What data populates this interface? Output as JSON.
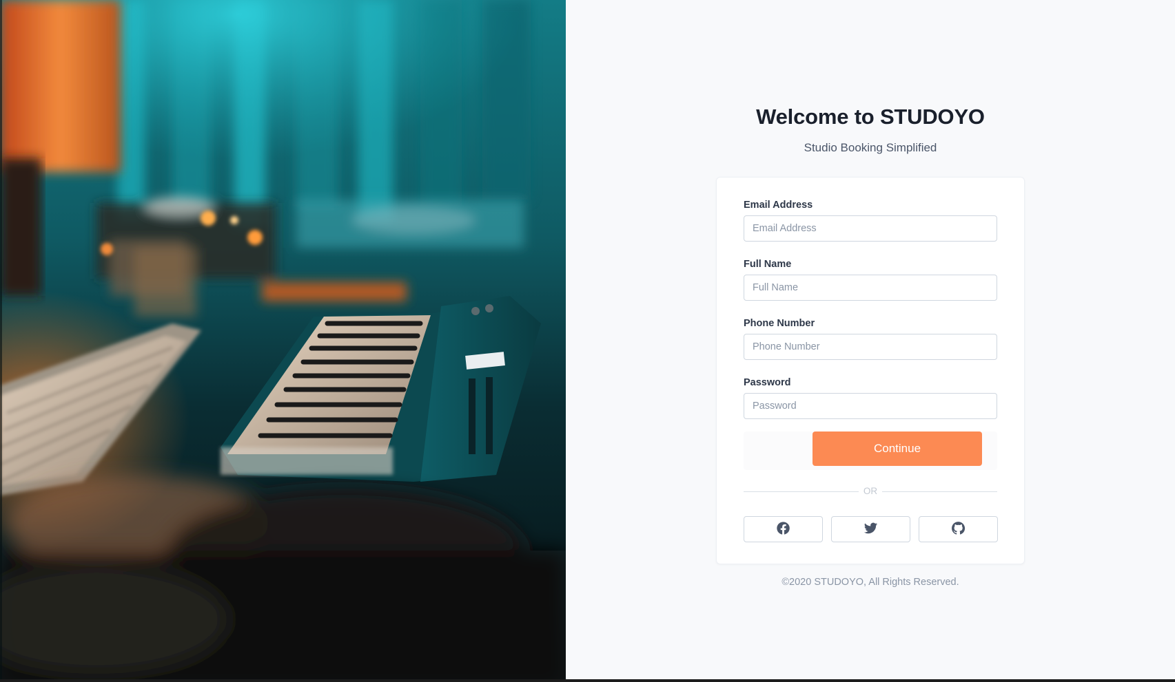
{
  "hero": {
    "photo_subject": "music studio keyboard and MIDI controller photo",
    "colors": {
      "teal": "#17a6b3",
      "orange": "#e8792b",
      "dark": "#0b1518"
    }
  },
  "header": {
    "title": "Welcome to STUDOYO",
    "subtitle": "Studio Booking Simplified"
  },
  "form": {
    "email": {
      "label": "Email Address",
      "placeholder": "Email Address",
      "value": ""
    },
    "full_name": {
      "label": "Full Name",
      "placeholder": "Full Name",
      "value": ""
    },
    "phone": {
      "label": "Phone Number",
      "placeholder": "Phone Number",
      "value": ""
    },
    "password": {
      "label": "Password",
      "placeholder": "Password",
      "value": ""
    },
    "continue_label": "Continue",
    "divider_text": "OR"
  },
  "social": [
    {
      "name": "facebook",
      "icon": "facebook-icon"
    },
    {
      "name": "twitter",
      "icon": "twitter-icon"
    },
    {
      "name": "github",
      "icon": "github-icon"
    }
  ],
  "footer": {
    "copyright": "©2020 STUDOYO, All Rights Reserved."
  },
  "colors": {
    "accent": "#fc8a53",
    "title": "#1a202c",
    "muted": "#8a95a5",
    "background": "#f8f9fb"
  }
}
